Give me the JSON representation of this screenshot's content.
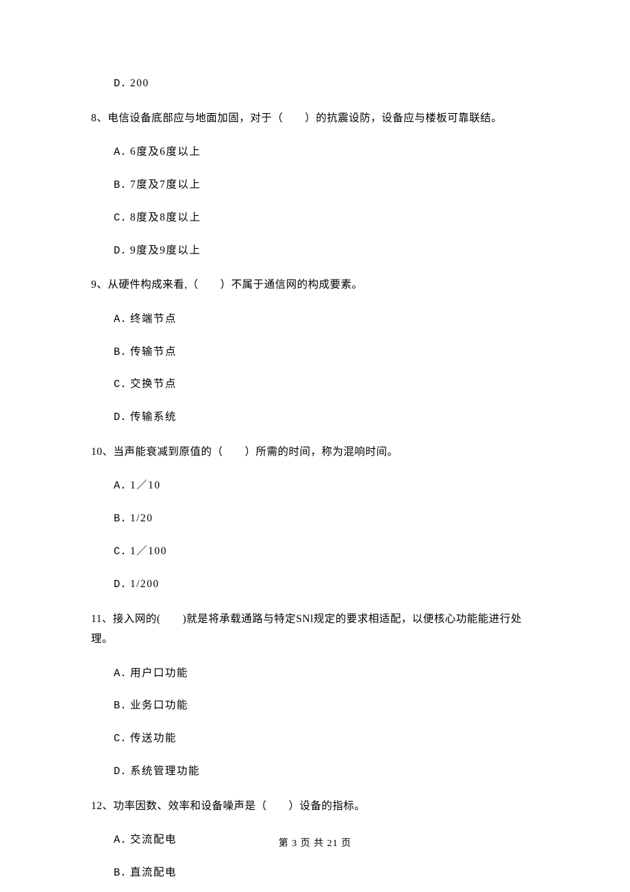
{
  "q7_option_d": {
    "letter": "D.",
    "text": "200"
  },
  "q8": {
    "text": "8、电信设备底部应与地面加固，对于（　　）的抗震设防，设备应与楼板可靠联结。",
    "options": {
      "a": {
        "letter": "A.",
        "text": "6度及6度以上"
      },
      "b": {
        "letter": "B.",
        "text": "7度及7度以上"
      },
      "c": {
        "letter": "C.",
        "text": "8度及8度以上"
      },
      "d": {
        "letter": "D.",
        "text": "9度及9度以上"
      }
    }
  },
  "q9": {
    "text": "9、从硬件构成来看,（　　）不属于通信网的构成要素。",
    "options": {
      "a": {
        "letter": "A.",
        "text": "终端节点"
      },
      "b": {
        "letter": "B.",
        "text": "传输节点"
      },
      "c": {
        "letter": "C.",
        "text": "交换节点"
      },
      "d": {
        "letter": "D.",
        "text": "传输系统"
      }
    }
  },
  "q10": {
    "text": "10、当声能衰减到原值的（　　）所需的时间，称为混响时间。",
    "options": {
      "a": {
        "letter": "A.",
        "text": " 1／10"
      },
      "b": {
        "letter": "B.",
        "text": " 1/20"
      },
      "c": {
        "letter": "C.",
        "text": " 1／100"
      },
      "d": {
        "letter": "D.",
        "text": " 1/200"
      }
    }
  },
  "q11": {
    "text": "11、接入网的(　　)就是将承载通路与特定SNl规定的要求相适配，以便核心功能能进行处理。",
    "options": {
      "a": {
        "letter": "A.",
        "text": "用户口功能"
      },
      "b": {
        "letter": "B.",
        "text": "业务口功能"
      },
      "c": {
        "letter": "C.",
        "text": "传送功能"
      },
      "d": {
        "letter": "D.",
        "text": "系统管理功能"
      }
    }
  },
  "q12": {
    "text": "12、功率因数、效率和设备噪声是（　　）设备的指标。",
    "options": {
      "a": {
        "letter": "A.",
        "text": "交流配电"
      },
      "b": {
        "letter": "B.",
        "text": "直流配电"
      }
    }
  },
  "footer": "第 3 页 共 21 页"
}
